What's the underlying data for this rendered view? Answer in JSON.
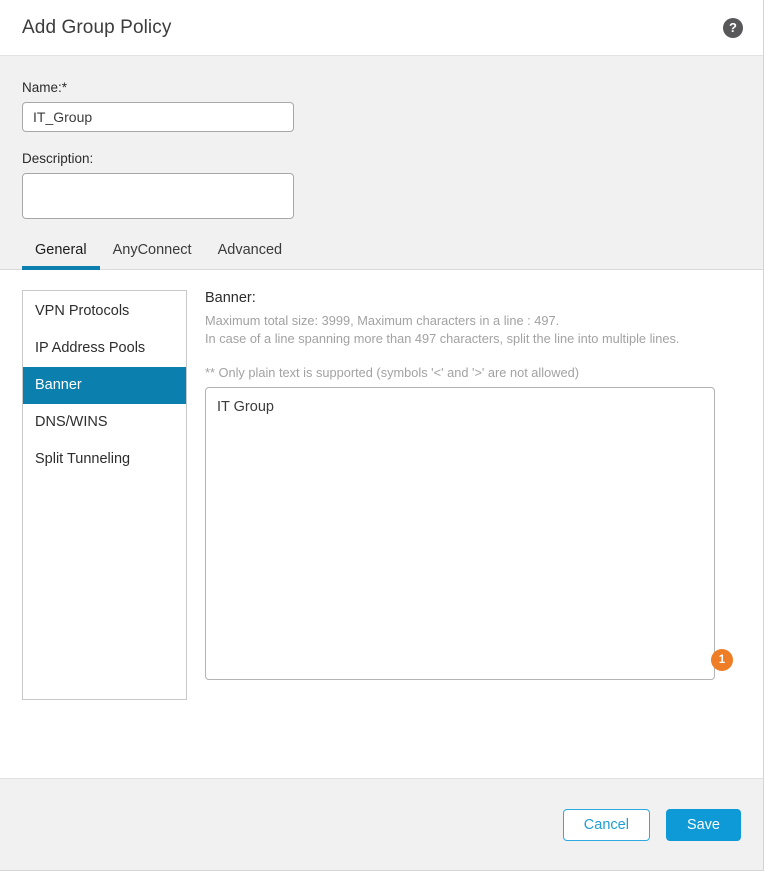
{
  "header": {
    "title": "Add Group Policy",
    "help_icon": "help-circle-icon",
    "help_glyph": "?"
  },
  "form": {
    "name": {
      "label": "Name:*",
      "value": "IT_Group",
      "placeholder": ""
    },
    "description": {
      "label": "Description:",
      "value": "",
      "placeholder": ""
    }
  },
  "tabs": [
    {
      "label": "General",
      "active": true
    },
    {
      "label": "AnyConnect",
      "active": false
    },
    {
      "label": "Advanced",
      "active": false
    }
  ],
  "sidebar": {
    "items": [
      {
        "label": "VPN Protocols",
        "active": false
      },
      {
        "label": "IP Address Pools",
        "active": false
      },
      {
        "label": "Banner",
        "active": true
      },
      {
        "label": "DNS/WINS",
        "active": false
      },
      {
        "label": "Split Tunneling",
        "active": false
      }
    ]
  },
  "panel": {
    "title": "Banner:",
    "hint_line1": "Maximum total size: 3999, Maximum characters in a line : 497.",
    "hint_line2": "In case of a line spanning more than 497 characters, split the line into multiple lines.",
    "note": "** Only plain text is supported (symbols '<' and '>' are not allowed)",
    "banner_value": "IT Group",
    "banner_placeholder": "",
    "badge_count": "1"
  },
  "footer": {
    "cancel_label": "Cancel",
    "save_label": "Save"
  },
  "colors": {
    "accent_blue": "#0b7fae",
    "button_blue": "#0d9ad6",
    "cancel_border": "#2eaae0",
    "badge_orange": "#ee7d26",
    "panel_bg": "#f1f1f1",
    "hint_gray": "#a2a2a2"
  }
}
